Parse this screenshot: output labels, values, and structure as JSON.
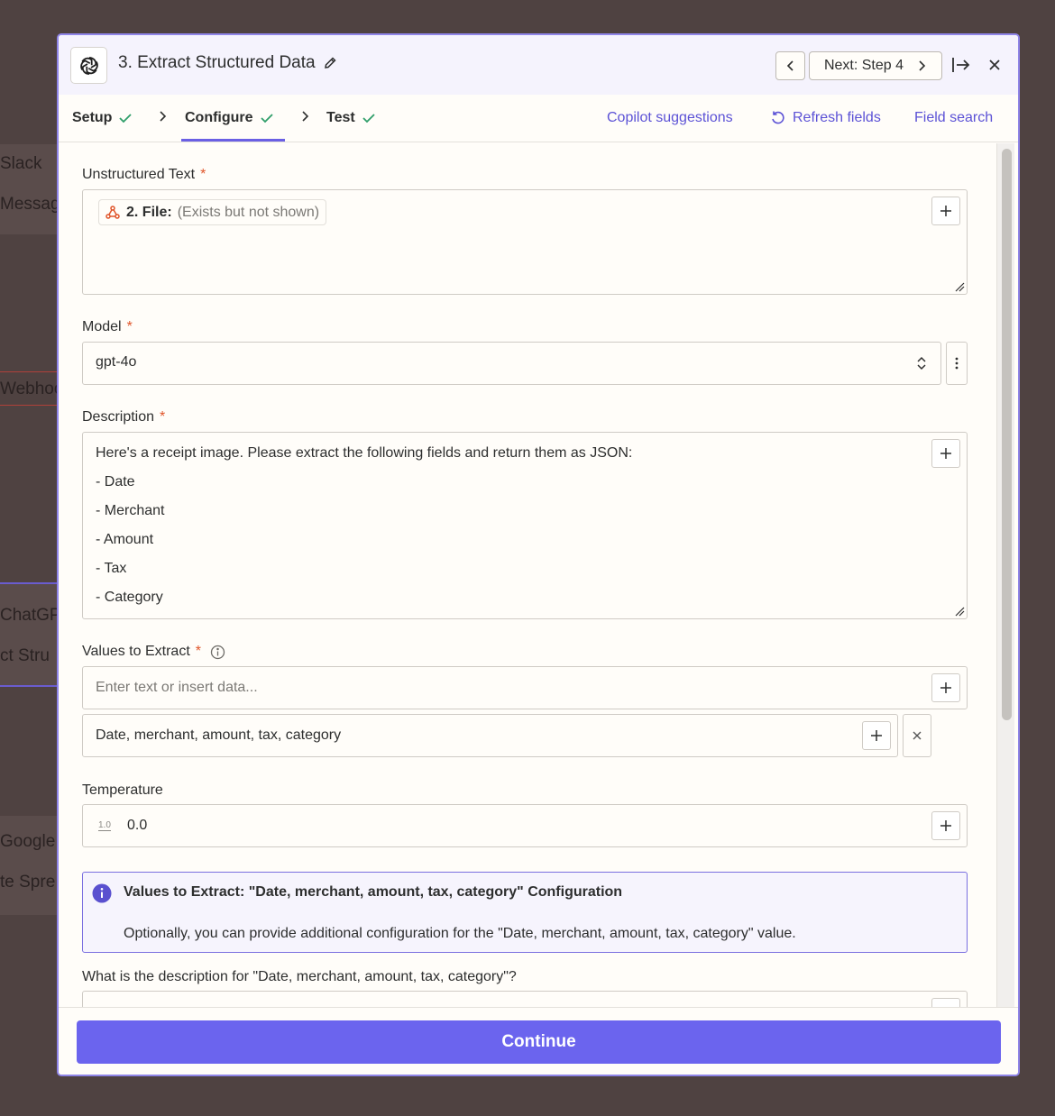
{
  "background": {
    "fragments": [
      "Slack",
      "Messag",
      "Webhoo",
      "ChatGP",
      "ct Stru",
      "Google",
      "te Spre"
    ]
  },
  "header": {
    "title": "3. Extract Structured Data",
    "next_label": "Next: Step 4",
    "app_icon": "openai-icon"
  },
  "tabs": {
    "setup": "Setup",
    "configure": "Configure",
    "test": "Test",
    "copilot": "Copilot suggestions",
    "refresh": "Refresh fields",
    "field_search": "Field search"
  },
  "form": {
    "unstructured_text": {
      "label": "Unstructured Text",
      "required_mark": "*",
      "pill_label": "2. File:",
      "pill_value": "(Exists but not shown)"
    },
    "model": {
      "label": "Model",
      "required_mark": "*",
      "value": "gpt-4o"
    },
    "description": {
      "label": "Description",
      "required_mark": "*",
      "lines": [
        "Here's a receipt image. Please extract the following fields and return them as JSON:",
        "- Date",
        "- Merchant",
        "- Amount",
        "- Tax",
        "- Category"
      ]
    },
    "values_to_extract": {
      "label": "Values to Extract",
      "required_mark": "*",
      "placeholder": "Enter text or insert data...",
      "item": "Date, merchant, amount, tax, category"
    },
    "temperature": {
      "label": "Temperature",
      "prefix": "1.0",
      "value": "0.0"
    },
    "info": {
      "title": "Values to Extract: \"Date, merchant, amount, tax, category\" Configuration",
      "body": "Optionally, you can provide additional configuration for the \"Date, merchant, amount, tax, category\" value."
    },
    "next_question": {
      "label": "What is the description for \"Date, merchant, amount, tax, category\"?"
    }
  },
  "footer": {
    "continue_label": "Continue"
  },
  "colors": {
    "accent": "#6b64ee",
    "required": "#e0552a",
    "check": "#2f9e6a",
    "link": "#5c52d6"
  }
}
